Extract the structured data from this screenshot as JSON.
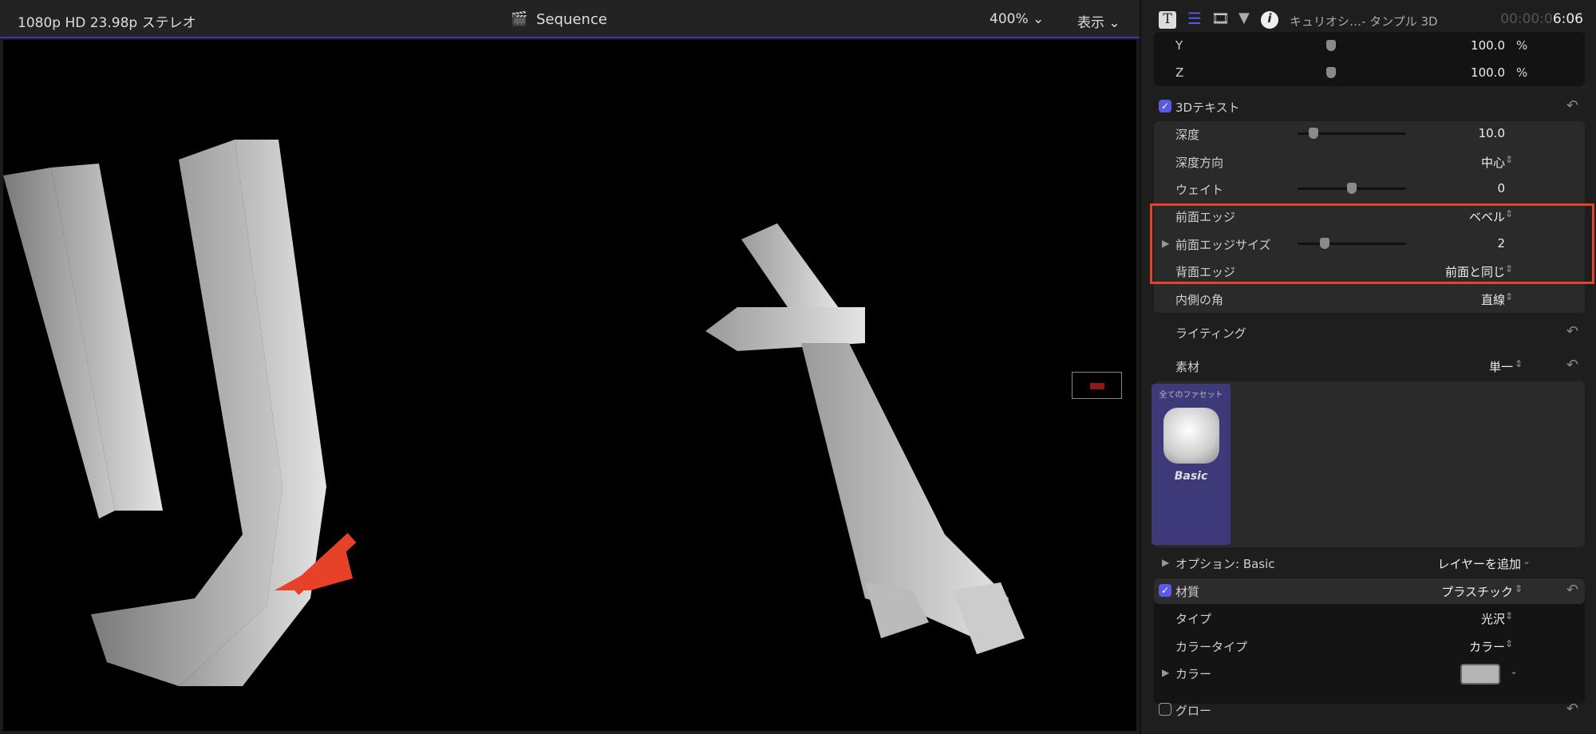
{
  "viewer": {
    "format": "1080p HD 23.98p ステレオ",
    "title": "Sequence",
    "zoom": "400%",
    "view_menu": "表示"
  },
  "inspector": {
    "title": "キュリオシ…- タンプル 3D",
    "timecode_dim": "00:00:0",
    "timecode": "6:06",
    "scale": [
      {
        "label": "Y",
        "value": "100.0",
        "unit": "%",
        "slider": 0.45
      },
      {
        "label": "Z",
        "value": "100.0",
        "unit": "%",
        "slider": 0.45
      }
    ],
    "text3d": {
      "label": "3Dテキスト",
      "checked": true,
      "depth": {
        "label": "深度",
        "value": "10.0",
        "slider": 0.2
      },
      "depth_dir": {
        "label": "深度方向",
        "value": "中心"
      },
      "weight": {
        "label": "ウェイト",
        "value": "0",
        "slider": 0.5
      },
      "front_edge": {
        "label": "前面エッジ",
        "value": "ベベル"
      },
      "front_edge_size": {
        "label": "前面エッジサイズ",
        "value": "2",
        "slider": 0.25
      },
      "back_edge": {
        "label": "背面エッジ",
        "value": "前面と同じ"
      },
      "inner_corner": {
        "label": "内側の角",
        "value": "直線"
      }
    },
    "lighting": {
      "label": "ライティング"
    },
    "material": {
      "label": "素材",
      "value": "単一"
    },
    "facet": {
      "header": "全てのファセット",
      "name": "Basic"
    },
    "options": {
      "label": "オプション: Basic",
      "add_layer": "レイヤーを追加"
    },
    "substance": {
      "label": "材質",
      "value": "プラスチック",
      "checked": true
    },
    "type": {
      "label": "タイプ",
      "value": "光沢"
    },
    "color_type": {
      "label": "カラータイプ",
      "value": "カラー"
    },
    "color": {
      "label": "カラー",
      "swatch": "#b4b4b4"
    },
    "glow": {
      "label": "グロー",
      "checked": false
    }
  },
  "colors": {
    "highlight": "#e8412a",
    "accent": "#5a5ae6"
  }
}
